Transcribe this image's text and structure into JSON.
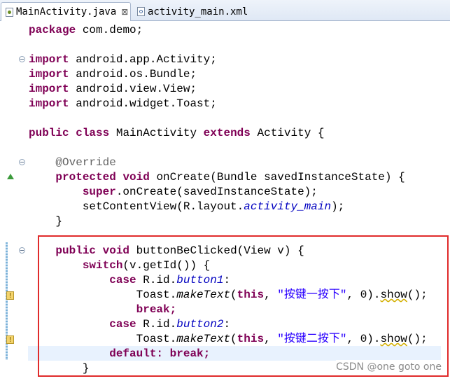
{
  "tabs": [
    {
      "label": "MainActivity.java",
      "close": "⊠",
      "icon": "java-file-icon",
      "active": true
    },
    {
      "label": "activity_main.xml",
      "icon": "xml-file-icon",
      "active": false
    }
  ],
  "code": {
    "package_kw": "package",
    "package_name": "com.demo;",
    "import_kw": "import",
    "imports": [
      "android.app.Activity;",
      "android.os.Bundle;",
      "android.view.View;",
      "android.widget.Toast;"
    ],
    "class_decl": {
      "public": "public",
      "class": "class",
      "name": "MainActivity",
      "extends": "extends",
      "parent": "Activity {"
    },
    "override": "@Override",
    "oncreate_sig": {
      "protected": "protected",
      "void": "void",
      "rest": "onCreate(Bundle savedInstanceState) {"
    },
    "super_call": {
      "super": "super",
      "rest": ".onCreate(savedInstanceState);"
    },
    "setcontent": {
      "pre": "setContentView(R.layout.",
      "field": "activity_main",
      "post": ");"
    },
    "close_brace": "}",
    "button_sig": {
      "public": "public",
      "void": "void",
      "rest": "buttonBeClicked(View v) {"
    },
    "switch_line": {
      "switch": "switch",
      "rest": "(v.getId()) {"
    },
    "case_kw": "case",
    "case1": {
      "pre": "R.id.",
      "field": "button1",
      "post": ":"
    },
    "case2": {
      "pre": "R.id.",
      "field": "button2",
      "post": ":"
    },
    "toast1": {
      "pre": "Toast.",
      "method": "makeText",
      "open": "(",
      "this": "this",
      "comma": ", ",
      "str": "\"按键一按下\"",
      "tail": ", 0).",
      "show": "show",
      "end": "();"
    },
    "toast2": {
      "pre": "Toast.",
      "method": "makeText",
      "open": "(",
      "this": "this",
      "comma": ", ",
      "str": "\"按键二按下\"",
      "tail": ", 0).",
      "show": "show",
      "end": "();"
    },
    "break_stmt": "break;",
    "default_kw": "default:",
    "default_break": "break;",
    "switch_close": "}"
  },
  "colors": {
    "keyword": "#7f0055",
    "field": "#0000c0",
    "string": "#2a00ff",
    "annotation": "#646464",
    "highlight_border": "#e02b2b"
  },
  "watermark": "CSDN @one goto one"
}
